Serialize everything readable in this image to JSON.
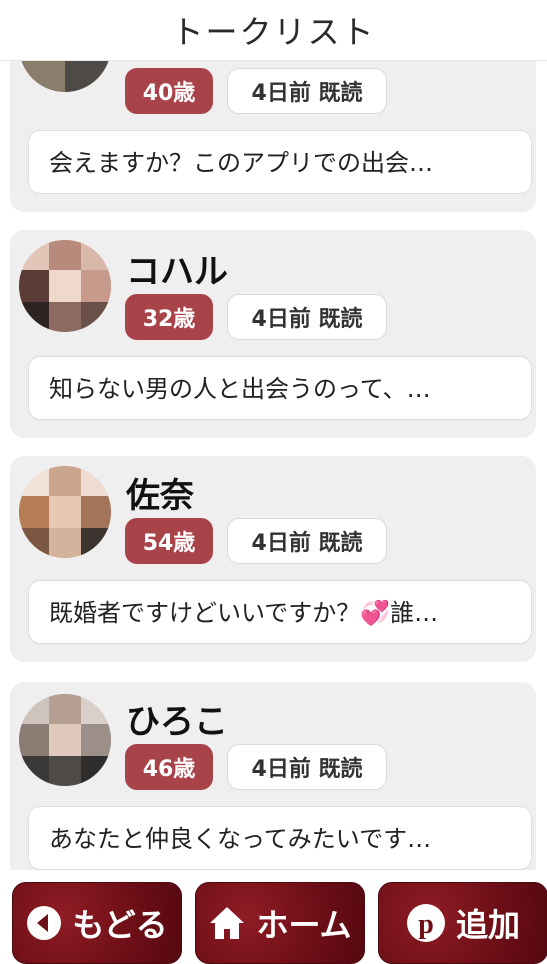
{
  "header": {
    "title": "トークリスト"
  },
  "conversations": [
    {
      "name": "",
      "age": "40歳",
      "status": "4日前  既読",
      "message": "会えますか？このアプリでの出会…"
    },
    {
      "name": "コハル",
      "age": "32歳",
      "status": "4日前  既読",
      "message": "知らない男の人と出会うのって、…"
    },
    {
      "name": "佐奈",
      "age": "54歳",
      "status": "4日前  既読",
      "message": "既婚者ですけどいいですか？",
      "message_tail": "誰…"
    },
    {
      "name": "ひろこ",
      "age": "46歳",
      "status": "4日前  既読",
      "message": "あなたと仲良くなってみたいです…"
    }
  ],
  "footer": {
    "back_label": "もどる",
    "home_label": "ホーム",
    "add_label": "追加"
  },
  "colors": {
    "age_badge": "#a8434a",
    "footer_button": "#6e0f17"
  }
}
